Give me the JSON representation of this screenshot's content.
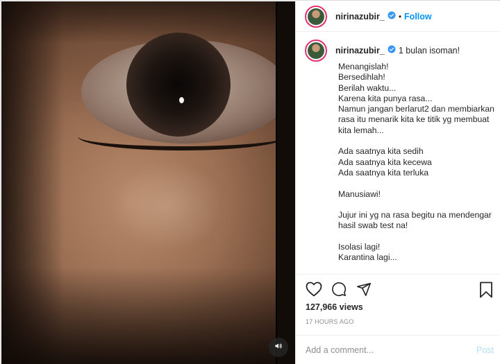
{
  "post": {
    "username": "nirinazubir_",
    "follow_label": "Follow",
    "dot": "•",
    "caption_first": "1 bulan isoman!",
    "caption_body": "Menangislah!\nBersedihlah!\nBerilah waktu...\nKarena kita punya rasa...\nNamun jangan berlarut2 dan membiarkan rasa itu menarik kita ke titik yg membuat kita lemah...\n\nAda saatnya kita sedih\nAda saatnya kita kecewa\nAda saatnya kita terluka\n\nManusiawi!\n\nJujur ini yg na rasa begitu na mendengar hasil swab test na!\n\nIsolasi lagi!\nKarantina lagi...",
    "views": "127,966 views",
    "time": "17 HOURS AGO",
    "comment_placeholder": "Add a comment...",
    "post_label": "Post"
  },
  "icons": {
    "verified": "verified-badge-icon",
    "like": "heart-icon",
    "comment": "comment-bubble-icon",
    "share": "paper-plane-icon",
    "save": "bookmark-icon",
    "sound": "speaker-icon"
  },
  "colors": {
    "accent": "#0095f6",
    "post_disabled": "#b2dffc",
    "muted": "#8e8e8e"
  }
}
